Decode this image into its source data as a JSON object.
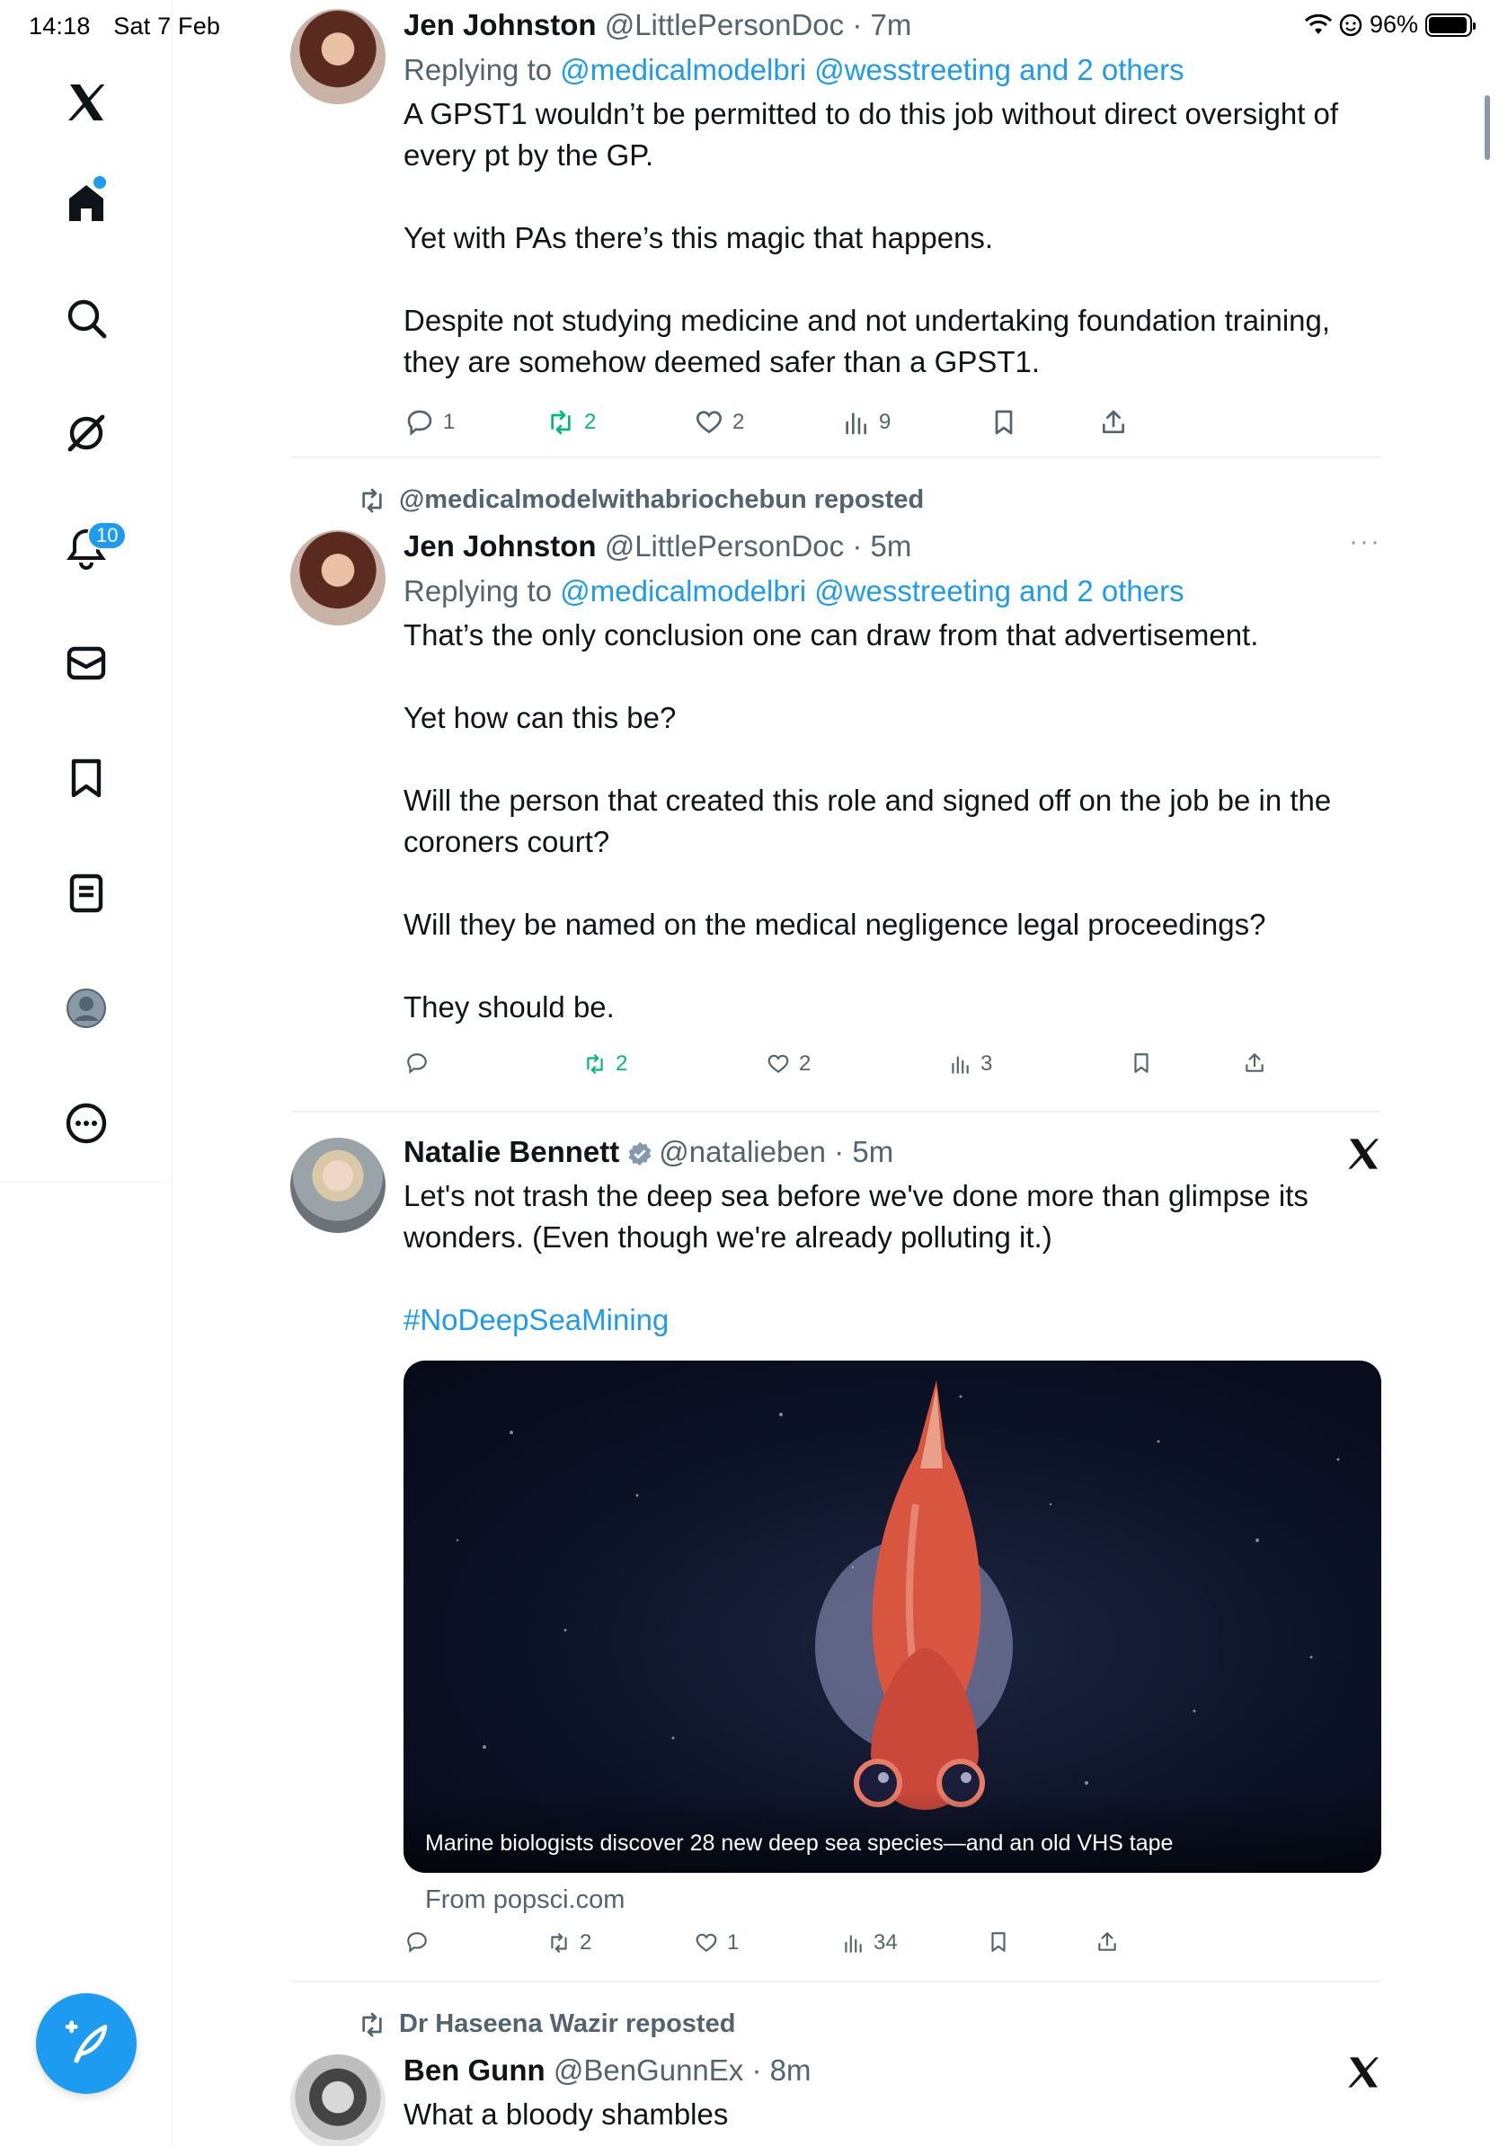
{
  "status_bar": {
    "time": "14:18",
    "date": "Sat 7 Feb",
    "battery": "96%",
    "battery_level": 0.96
  },
  "sidebar": {
    "items": [
      {
        "icon": "x-logo-icon"
      },
      {
        "icon": "home-icon",
        "has_dot": true
      },
      {
        "icon": "search-icon"
      },
      {
        "icon": "grok-icon"
      },
      {
        "icon": "notifications-icon",
        "badge": "10"
      },
      {
        "icon": "messages-icon"
      },
      {
        "icon": "bookmarks-icon"
      },
      {
        "icon": "lists-icon"
      },
      {
        "icon": "profile-icon"
      },
      {
        "icon": "more-icon"
      }
    ],
    "compose_icon": "compose-icon"
  },
  "tweets": [
    {
      "name": "Jen Johnston",
      "handle": "@LittlePersonDoc",
      "time": "7m",
      "replying_prefix": "Replying to ",
      "replying_to": "@medicalmodelbri @wesstreeting and 2 others",
      "paragraphs": [
        "A GPST1 wouldn’t be permitted to do this job without direct oversight of every pt by the GP.",
        "Yet with PAs there’s this magic that happens.",
        "Despite not studying medicine and not undertaking foundation training, they are somehow deemed safer than a GPST1."
      ],
      "replies": "1",
      "reposts": "2",
      "likes": "2",
      "views": "9"
    },
    {
      "reposted_by": "@medicalmodelwithabriochebun reposted",
      "name": "Jen Johnston",
      "handle": "@LittlePersonDoc",
      "time": "5m",
      "more": "···",
      "replying_prefix": "Replying to ",
      "replying_to": "@medicalmodelbri @wesstreeting and 2 others",
      "paragraphs": [
        "That’s the only conclusion one can draw from that advertisement.",
        "Yet how can this be?",
        "Will the person that created this role and signed off on the job be in the coroners court?",
        "Will they be named on the medical negligence legal proceedings?",
        "They should be."
      ],
      "replies": "",
      "reposts": "2",
      "likes": "2",
      "views": "3"
    },
    {
      "name": "Natalie Bennett",
      "handle": "@natalieben",
      "time": "5m",
      "verified": true,
      "paragraphs": [
        "Let's not trash the deep sea before we've done more than glimpse its wonders. (Even though we're already polluting it.)",
        "#NoDeepSeaMining"
      ],
      "card_title": "Marine biologists discover 28 new deep sea species—and an old VHS tape",
      "card_source": "From popsci.com",
      "replies": "",
      "reposts": "2",
      "likes": "1",
      "views": "34"
    },
    {
      "reposted_by": "Dr Haseena Wazir reposted",
      "name": "Ben Gunn",
      "handle": "@BenGunnEx",
      "time": "8m",
      "paragraphs": [
        "What a bloody shambles"
      ]
    }
  ],
  "separator": " · "
}
